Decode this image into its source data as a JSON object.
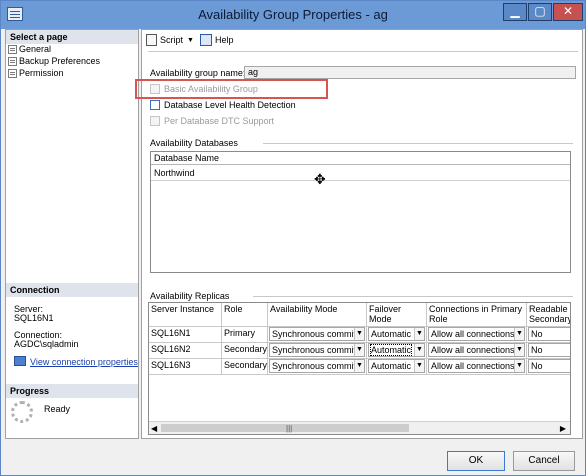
{
  "window": {
    "title": "Availability Group Properties - ag",
    "min_label": "▁",
    "max_label": "▢",
    "close_label": "✕"
  },
  "left": {
    "select_page_header": "Select a page",
    "pages": [
      "General",
      "Backup Preferences",
      "Permission"
    ],
    "connection_header": "Connection",
    "server_label": "Server:",
    "server_value": "SQL16N1",
    "connection_label": "Connection:",
    "connection_value": "AGDC\\sqladmin",
    "view_connection_link": "View connection properties",
    "progress_header": "Progress",
    "progress_status": "Ready"
  },
  "toolbar": {
    "script_label": "Script",
    "help_label": "Help"
  },
  "general": {
    "ag_name_label": "Availability group name:",
    "ag_name_value": "ag",
    "basic_ag_label": "Basic Availability Group",
    "db_health_label": "Database Level Health Detection",
    "dtc_label": "Per Database DTC Support",
    "availability_databases_label": "Availability Databases",
    "db_column_header": "Database Name",
    "databases": [
      "Northwind"
    ],
    "availability_replicas_label": "Availability Replicas"
  },
  "replicas": {
    "headers": {
      "server_instance": "Server Instance",
      "role": "Role",
      "availability_mode": "Availability Mode",
      "failover_mode": "Failover Mode",
      "connections_primary": "Connections in Primary Role",
      "readable_secondary": "Readable Secondary"
    },
    "rows": [
      {
        "server": "SQL16N1",
        "role": "Primary",
        "mode": "Synchronous commit",
        "failover": "Automatic",
        "connections": "Allow all connections",
        "readable": "No"
      },
      {
        "server": "SQL16N2",
        "role": "Secondary",
        "mode": "Synchronous commit",
        "failover": "Automatic",
        "connections": "Allow all connections",
        "readable": "No"
      },
      {
        "server": "SQL16N3",
        "role": "Secondary",
        "mode": "Synchronous commit",
        "failover": "Automatic",
        "connections": "Allow all connections",
        "readable": "No"
      }
    ],
    "scroll_grip": "|||"
  },
  "footer": {
    "ok_label": "OK",
    "cancel_label": "Cancel"
  },
  "colors": {
    "titlebar": "#6b9ad6",
    "close_button": "#c75050",
    "highlight_box": "#d9534f",
    "link": "#1a3fb0"
  }
}
